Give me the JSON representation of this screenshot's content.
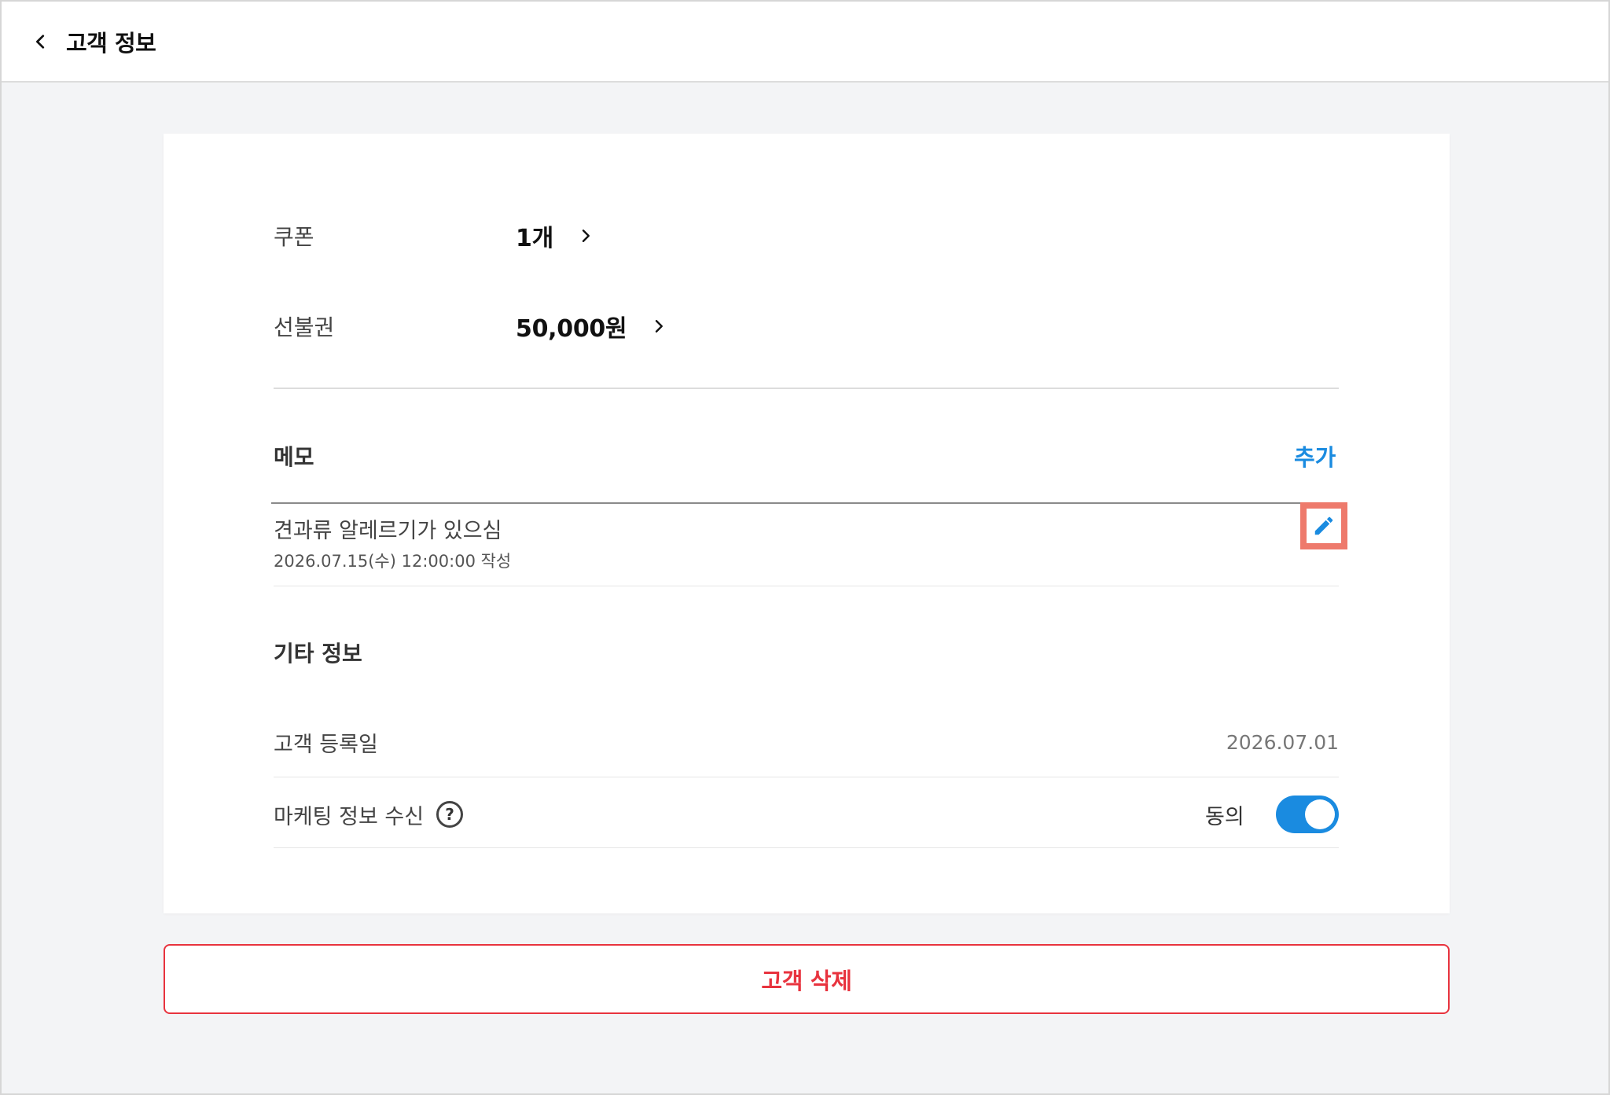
{
  "header": {
    "title": "고객 정보",
    "back_icon": "chevron-left-icon"
  },
  "benefits": {
    "coupon_label": "쿠폰",
    "coupon_value": "1개",
    "prepaid_label": "선불권",
    "prepaid_value": "50,000원"
  },
  "memo": {
    "title": "메모",
    "add_label": "추가",
    "items": [
      {
        "text": "견과류 알레르기가 있으심",
        "date": "2026.07.15(수) 12:00:00 작성"
      }
    ]
  },
  "other_info": {
    "title": "기타 정보",
    "registered_label": "고객 등록일",
    "registered_value": "2026.07.01",
    "marketing_label": "마케팅 정보 수신",
    "marketing_status": "동의",
    "marketing_enabled": true
  },
  "actions": {
    "delete_label": "고객 삭제"
  },
  "colors": {
    "accent": "#1a8be0",
    "danger": "#e8333e",
    "highlight": "#ee7a6c"
  }
}
